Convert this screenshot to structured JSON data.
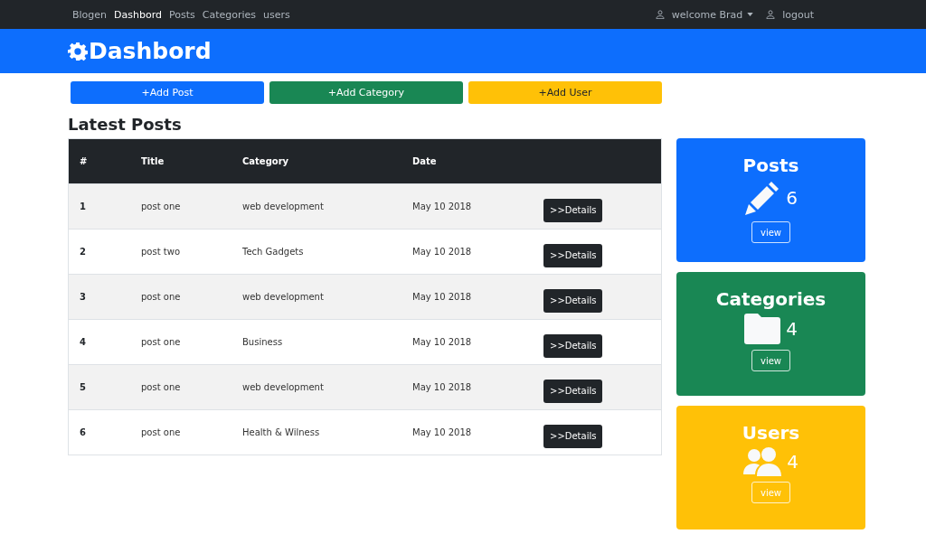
{
  "navbar": {
    "brand": "Blogen",
    "links": [
      {
        "label": "Dashbord",
        "selected": true
      },
      {
        "label": "Posts",
        "selected": false
      },
      {
        "label": "Categories",
        "selected": false
      },
      {
        "label": "users",
        "selected": false
      }
    ],
    "user_menu": "welcome Brad",
    "logout": "logout"
  },
  "header": {
    "title": "Dashbord"
  },
  "actions": [
    {
      "label": "+Add Post",
      "color": "#0d6efd"
    },
    {
      "label": "+Add Category",
      "color": "#198754"
    },
    {
      "label": "+Add User",
      "color": "#ffc107"
    }
  ],
  "posts": {
    "heading": "Latest Posts",
    "columns": [
      "#",
      "Title",
      "Category",
      "Date"
    ],
    "rows": [
      {
        "number": "1",
        "title": "post one",
        "category": "web development",
        "date": "May 10 2018",
        "action": ">>Details"
      },
      {
        "number": "2",
        "title": "post two",
        "category": "Tech Gadgets",
        "date": "May 10 2018",
        "action": ">>Details"
      },
      {
        "number": "3",
        "title": "post one",
        "category": "web development",
        "date": "May 10 2018",
        "action": ">>Details"
      },
      {
        "number": "4",
        "title": "post one",
        "category": "Business",
        "date": "May 10 2018",
        "action": ">>Details"
      },
      {
        "number": "5",
        "title": "post one",
        "category": "web development",
        "date": "May 10 2018",
        "action": ">>Details"
      },
      {
        "number": "6",
        "title": "post one",
        "category": "Health & Wilness",
        "date": "May 10 2018",
        "action": ">>Details"
      }
    ]
  },
  "stats": [
    {
      "kind": "posts",
      "title": "Posts",
      "count": "6",
      "button": "view",
      "color": "#0d6efd"
    },
    {
      "kind": "categories",
      "title": "Categories",
      "count": "4",
      "button": "view",
      "color": "#198754"
    },
    {
      "kind": "users",
      "title": "Users",
      "count": "4",
      "button": "view",
      "color": "#ffc107"
    }
  ]
}
